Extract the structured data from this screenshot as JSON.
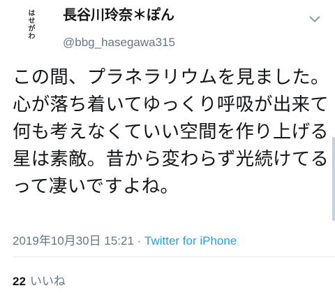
{
  "tweet": {
    "avatar_text": "はせがわ",
    "display_name": "長谷川玲奈＊ぽん",
    "handle": "@bbg_hasegawa315",
    "text": "この間、プラネラリウムを見ました。心が落ち着いてゆっくり呼吸が出来て何も考えなくていい空間を作り上げる星は素敵。昔から変わらず光続けてるって凄いですよね。",
    "timestamp": "2019年10月30日 15:21",
    "separator": " · ",
    "source": "Twitter for iPhone",
    "likes_count": "22",
    "likes_label": "いいね"
  },
  "colors": {
    "text": "#14171a",
    "secondary": "#657786",
    "link": "#1da1f2",
    "divider": "#e1e8ed"
  },
  "icons": {
    "caret": "chevron-down-icon"
  }
}
